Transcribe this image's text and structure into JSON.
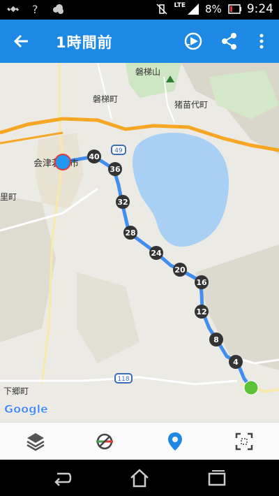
{
  "status_bar": {
    "left_icons": [
      "satellite-icon",
      "question-icon",
      "cloud-icon"
    ],
    "network": "LTE",
    "battery": "8%",
    "time": "9:24"
  },
  "app_bar": {
    "title": "1時間前",
    "back_icon": "arrow-left-icon",
    "actions": [
      "playback-icon",
      "share-icon",
      "more-vert-icon"
    ]
  },
  "map": {
    "labels": {
      "bandai_san": "磐梯山",
      "bandai_machi": "磐梯町",
      "inawashiro_machi": "猪苗代町",
      "aizu_wakamatsu": "会津若松市",
      "nishi_machi": "里町",
      "shimogo_machi": "下郷町"
    },
    "road_shields": {
      "r49": "49",
      "r118": "118"
    },
    "attribution": "Google",
    "route_markers": [
      "40",
      "36",
      "32",
      "28",
      "24",
      "20",
      "16",
      "12",
      "8",
      "4"
    ],
    "colors": {
      "route": "#3f8ef0",
      "start_marker": "#5bc236",
      "end_marker": "#2196f3",
      "highway": "#f6a623",
      "lake": "#a8d0f5"
    }
  },
  "bottom_toolbar": {
    "items": [
      "layers-icon",
      "track-color-icon",
      "location-pin-icon",
      "fit-screen-icon"
    ],
    "accent": "#1e88e5"
  },
  "nav_bar": {
    "items": [
      "back-icon",
      "home-icon",
      "recents-icon"
    ]
  }
}
